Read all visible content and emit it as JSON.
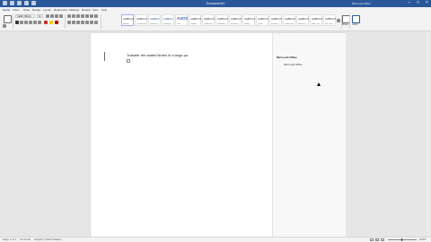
{
  "app": {
    "doc_title": "Document1",
    "user": "Microsoft Office"
  },
  "quick_access": [
    "autosave-toggle",
    "save-icon",
    "undo-icon",
    "redo-icon",
    "customize-icon"
  ],
  "window_controls": {
    "minimize": "–",
    "maximize": "□",
    "close": "×"
  },
  "tabs": [
    "Home",
    "Insert",
    "Draw",
    "Design",
    "Layout",
    "References",
    "Mailings",
    "Review",
    "View",
    "Help"
  ],
  "ribbon": {
    "font_name": "Calibri (Body)",
    "font_size": "11",
    "styles": [
      {
        "preview": "AaBbCcDd",
        "label": "Normal"
      },
      {
        "preview": "AaBbCcDd",
        "label": "No Spacing"
      },
      {
        "preview": "AaBbCc",
        "label": "Heading 1"
      },
      {
        "preview": "AaBbCc",
        "label": "Heading 2"
      },
      {
        "preview": "AaBbC",
        "label": "Title"
      },
      {
        "preview": "AaBbCcD",
        "label": "Subtitle"
      },
      {
        "preview": "AaBbCcDd",
        "label": "Subtle Em..."
      },
      {
        "preview": "AaBbCcDd",
        "label": "Emphasis"
      },
      {
        "preview": "AaBbCcDd",
        "label": "Intense E..."
      },
      {
        "preview": "AaBbCcDd",
        "label": "Strong"
      },
      {
        "preview": "AaBbCcDd",
        "label": "Quote"
      },
      {
        "preview": "AaBbCcDd",
        "label": "Intense Q..."
      },
      {
        "preview": "AaBbCcDd",
        "label": "Subtle Ref..."
      },
      {
        "preview": "AaBbCcDd",
        "label": "Intense R..."
      },
      {
        "preview": "AaBbCcDd",
        "label": "Book Title"
      },
      {
        "preview": "AaBbCcDd",
        "label": "List Para..."
      }
    ],
    "dictate_label": "Dictate",
    "editor_label": "Editor"
  },
  "document": {
    "line1": "Transfer the stated Notes in a large pa"
  },
  "comment": {
    "author": "Microsoft Office",
    "text": "Microsoft Office"
  },
  "status": {
    "page": "Page 1 of 1",
    "words": "10 words",
    "proofing": "English (United States)",
    "zoom": "100%"
  },
  "colors": {
    "accent": "#2b579a"
  }
}
